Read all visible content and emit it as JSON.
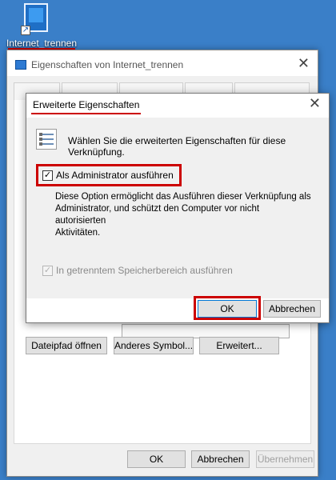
{
  "desktop": {
    "shortcut_label": "Internet_trennen"
  },
  "window": {
    "title": "Eigenschaften von Internet_trennen",
    "close_glyph": "✕",
    "buttons": {
      "ok": "OK",
      "cancel": "Abbrechen",
      "apply": "Übernehmen"
    },
    "actions": {
      "open_path": "Dateipfad öffnen",
      "change_icon": "Anderes Symbol...",
      "advanced": "Erweitert..."
    }
  },
  "dialog": {
    "title": "Erweiterte Eigenschaften",
    "close_glyph": "✕",
    "info_text": "Wählen Sie die erweiterten Eigenschaften für diese Verknüpfung.",
    "run_as_admin": {
      "label": "Als Administrator ausführen",
      "checked": true
    },
    "description_lines": [
      "Diese Option ermöglicht das Ausführen dieser Verknüpfung als",
      "Administrator, und schützt den Computer vor nicht autorisierten",
      "Aktivitäten."
    ],
    "separate_memory": {
      "label": "In getrenntem Speicherbereich ausführen",
      "checked": true,
      "enabled": false
    },
    "buttons": {
      "ok": "OK",
      "cancel": "Abbrechen"
    }
  },
  "colors": {
    "highlight": "#cc0000",
    "desktop_bg": "#3a7fc8"
  }
}
